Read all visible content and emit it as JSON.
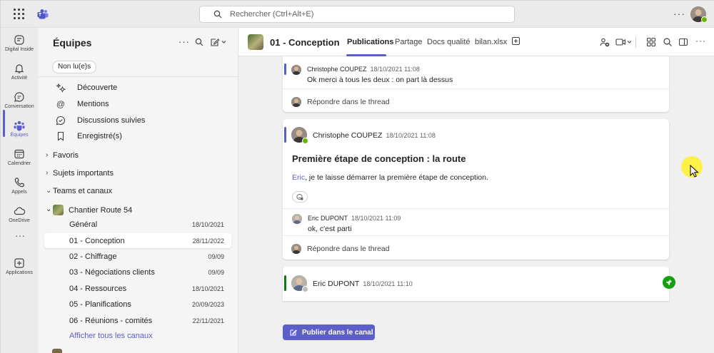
{
  "topbar": {
    "search_placeholder": "Rechercher (Ctrl+Alt+E)",
    "more": "···"
  },
  "rail": [
    {
      "label": "Digital Inside",
      "icon": "copilot-icon"
    },
    {
      "label": "Activité",
      "icon": "bell-icon"
    },
    {
      "label": "Conversation",
      "icon": "chat-icon"
    },
    {
      "label": "Équipes",
      "icon": "teams-icon",
      "active": true
    },
    {
      "label": "Calendrier",
      "icon": "calendar-icon"
    },
    {
      "label": "Appels",
      "icon": "phone-icon"
    },
    {
      "label": "OneDrive",
      "icon": "cloud-icon"
    },
    {
      "label": "Applications",
      "icon": "apps-icon"
    }
  ],
  "rail_more": "···",
  "sidebar": {
    "title": "Équipes",
    "filter": "Non lu(e)s",
    "nav": [
      {
        "label": "Découverte",
        "icon": "discover-icon"
      },
      {
        "label": "Mentions",
        "icon": "at-icon"
      },
      {
        "label": "Discussions suivies",
        "icon": "followed-icon"
      },
      {
        "label": "Enregistré(s)",
        "icon": "bookmark-icon"
      }
    ],
    "sections": [
      "Favoris",
      "Sujets importants",
      "Teams et canaux"
    ],
    "team": "Chantier Route 54",
    "channels": [
      {
        "name": "Général",
        "date": "18/10/2021"
      },
      {
        "name": "01 - Conception",
        "date": "28/11/2022",
        "selected": true
      },
      {
        "name": "02 - Chiffrage",
        "date": "09/09"
      },
      {
        "name": "03 - Négociations clients",
        "date": "09/09"
      },
      {
        "name": "04 - Ressources",
        "date": "18/10/2021"
      },
      {
        "name": "05 - Planifications",
        "date": "20/09/2023"
      },
      {
        "name": "06 - Réunions - comités",
        "date": "22/11/2021"
      }
    ],
    "show_all": "Afficher tous les canaux"
  },
  "header": {
    "title": "01 - Conception",
    "tabs": [
      "Publications",
      "Partage",
      "Docs qualité",
      "bilan.xlsx"
    ],
    "more": "···"
  },
  "posts": {
    "p1": {
      "author": "Christophe COUPEZ",
      "time": "18/10/2021 11:08",
      "text": "Ok merci à tous les deux : on part là dessus"
    },
    "reply_label": "Répondre dans le thread",
    "p2": {
      "author": "Christophe COUPEZ",
      "time": "18/10/2021 11:08",
      "subject": "Première étape de conception : la route",
      "mention": "Eric",
      "text": ", je te laisse démarrer la première étape de conception."
    },
    "p2r": {
      "author": "Eric DUPONT",
      "time": "18/10/2021 11:09",
      "text": "ok, c'est parti"
    },
    "p3": {
      "author": "Eric DUPONT",
      "time": "18/10/2021 11:10"
    }
  },
  "publish_label": "Publier dans le canal",
  "colors": {
    "accent": "#5b5fc7",
    "post_accent_green": "#107c10",
    "presence": "#6bb700"
  }
}
